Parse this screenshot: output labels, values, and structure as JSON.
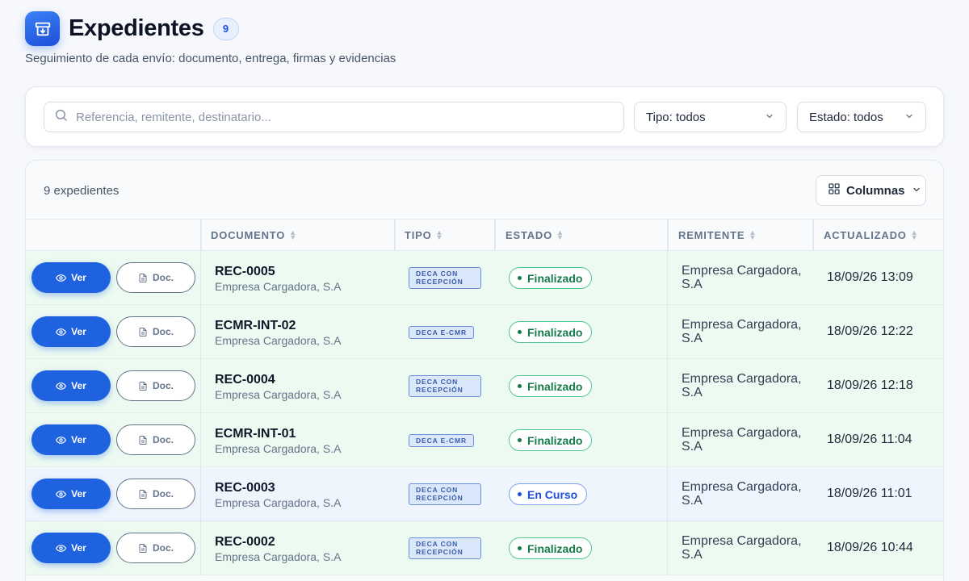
{
  "header": {
    "title": "Expedientes",
    "count": "9",
    "subtitle": "Seguimiento de cada envío: documento, entrega, firmas y evidencias"
  },
  "filters": {
    "search_placeholder": "Referencia, remitente, destinatario...",
    "tipo": "Tipo: todos",
    "estado": "Estado: todos"
  },
  "table": {
    "result_count": "9 expedientes",
    "columns_button": "Columnas",
    "headers": [
      "DOCUMENTO",
      "TIPO",
      "ESTADO",
      "REMITENTE",
      "ACTUALIZADO"
    ],
    "ver_label": "Ver",
    "doc_label": "Doc.",
    "rows": [
      {
        "ref": "REC-0005",
        "sub": "Empresa Cargadora, S.A",
        "tipo": "DECA CON RECEPCIÓN",
        "estado": "Finalizado",
        "remitente": "Empresa Cargadora, S.A",
        "actualizado": "18/09/26 13:09"
      },
      {
        "ref": "ECMR-INT-02",
        "sub": "Empresa Cargadora, S.A",
        "tipo": "DECA E-CMR",
        "estado": "Finalizado",
        "remitente": "Empresa Cargadora, S.A",
        "actualizado": "18/09/26 12:22"
      },
      {
        "ref": "REC-0004",
        "sub": "Empresa Cargadora, S.A",
        "tipo": "DECA CON RECEPCIÓN",
        "estado": "Finalizado",
        "remitente": "Empresa Cargadora, S.A",
        "actualizado": "18/09/26 12:18"
      },
      {
        "ref": "ECMR-INT-01",
        "sub": "Empresa Cargadora, S.A",
        "tipo": "DECA E-CMR",
        "estado": "Finalizado",
        "remitente": "Empresa Cargadora, S.A",
        "actualizado": "18/09/26 11:04"
      },
      {
        "ref": "REC-0003",
        "sub": "Empresa Cargadora, S.A",
        "tipo": "DECA CON RECEPCIÓN",
        "estado": "En Curso",
        "remitente": "Empresa Cargadora, S.A",
        "actualizado": "18/09/26 11:01"
      },
      {
        "ref": "REC-0002",
        "sub": "Empresa Cargadora, S.A",
        "tipo": "DECA CON RECEPCIÓN",
        "estado": "Finalizado",
        "remitente": "Empresa Cargadora, S.A",
        "actualizado": "18/09/26 10:44"
      }
    ]
  },
  "colors": {
    "accent": "#1e62e0",
    "finalizado": "#157a4a",
    "en_curso": "#1d4ed8"
  }
}
